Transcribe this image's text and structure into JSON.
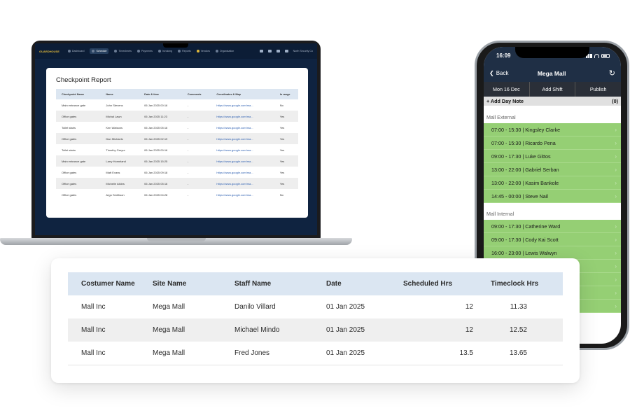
{
  "laptop": {
    "app_nav": {
      "logo": "GUARDHOUSE",
      "items": [
        "Dashboard",
        "Schedule",
        "Timesheets",
        "Payments",
        "Invoicing",
        "Reports",
        "Vendors",
        "Organisation"
      ],
      "active_item": "Schedule",
      "account": "North Security Co"
    },
    "report": {
      "title": "Checkpoint Report",
      "columns": [
        "Checkpoint Name",
        "Name",
        "Date & time",
        "Comments",
        "Coordinates & Map",
        "In range"
      ],
      "rows": [
        [
          "Main entrance gate",
          "John Stevens",
          "06 Jan 2025 00:16",
          "-",
          "https://www.google.com/ma...",
          "No"
        ],
        [
          "Office gates",
          "Michal Lawn",
          "06 Jan 2025 11:23",
          "-",
          "https://www.google.com/ma...",
          "Yes"
        ],
        [
          "Toilet stairs",
          "Ken Watsons",
          "06 Jan 2025 05:16",
          "-",
          "https://www.google.com/ma...",
          "Yes"
        ],
        [
          "Office gates",
          "Dan Michaels",
          "06 Jan 2025 02:19",
          "-",
          "https://www.google.com/ma...",
          "Yes"
        ],
        [
          "Toilet stairs",
          "Timothy Greyur",
          "06 Jan 2025 00:16",
          "-",
          "https://www.google.com/ma...",
          "Yes"
        ],
        [
          "Main entrance gate",
          "Larry Homeland",
          "06 Jan 2025 15:25",
          "-",
          "https://www.google.com/ma...",
          "Yes"
        ],
        [
          "Office gates",
          "Matt Evans",
          "06 Jan 2025 09:18",
          "-",
          "https://www.google.com/ma...",
          "Yes"
        ],
        [
          "Office gates",
          "Michelle Atkins",
          "06 Jan 2025 05:16",
          "-",
          "https://www.google.com/ma...",
          "Yes"
        ],
        [
          "Office gates",
          "Argo Smithson",
          "06 Jan 2025 04:28",
          "-",
          "https://www.google.com/ma...",
          "No"
        ]
      ]
    }
  },
  "phone": {
    "time": "16:09",
    "back_label": "Back",
    "title": "Mega Mall",
    "tabs": [
      "Mon 16 Dec",
      "Add Shift",
      "Publish"
    ],
    "day_note": "+ Add Day Note",
    "day_note_count": "(0)",
    "sections": [
      {
        "name": "Mall External",
        "shifts": [
          "07:00 - 15:30 | Kingsley Clarke",
          "07:00 - 15:30 | Ricardo Pena",
          "09:00 - 17:30 | Luke Gittos",
          "13:00 - 22:00 | Gabriel Serban",
          "13:00 - 22:00 | Kasim Bankole",
          "14:45 - 00:00 | Steve Nail"
        ]
      },
      {
        "name": "Mall Internal",
        "shifts": [
          "09:00 - 17:30 | Catherine Ward",
          "09:00 - 17:30 | Cody Kai  Scott",
          "16:00 - 23:00 | Lewis  Walwyn",
          "",
          "",
          "",
          ""
        ]
      }
    ]
  },
  "timesheet": {
    "columns": [
      "Costumer Name",
      "Site Name",
      "Staff Name",
      "Date",
      "Scheduled Hrs",
      "Timeclock Hrs"
    ],
    "rows": [
      [
        "Mall Inc",
        "Mega Mall",
        "Danilo Villard",
        "01 Jan 2025",
        "12",
        "11.33"
      ],
      [
        "Mall Inc",
        "Mega Mall",
        "Michael Mindo",
        "01 Jan 2025",
        "12",
        "12.52"
      ],
      [
        "Mall Inc",
        "Mega Mall",
        "Fred Jones",
        "01 Jan 2025",
        "13.5",
        "13.65"
      ]
    ]
  },
  "colors": {
    "app_navy": "#0f2340",
    "phone_header": "#1f2f45",
    "shift_green": "#95cf74",
    "table_header_blue": "#dbe6f2",
    "logo_gold": "#e0b83a"
  }
}
